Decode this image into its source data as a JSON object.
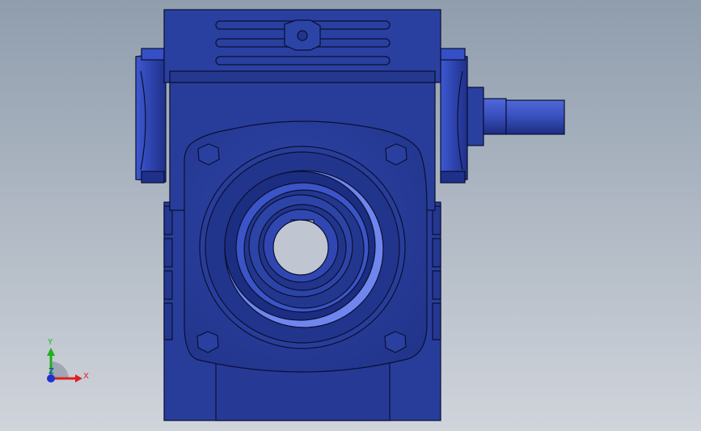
{
  "viewport": {
    "background_top": "#8f9dad",
    "background_bottom": "#d0d4db"
  },
  "model": {
    "part": "worm-gear-reducer",
    "color_body": "#283d9a",
    "color_dark": "#1a2a78",
    "color_light": "#3b55c8",
    "color_highlight": "#6f86ee",
    "color_edge": "#0a0f33"
  },
  "triad": {
    "x_label": "X",
    "y_label": "Y",
    "z_label": "Z",
    "x_color": "#e02020",
    "y_color": "#20b020",
    "z_color": "#2030d0"
  }
}
